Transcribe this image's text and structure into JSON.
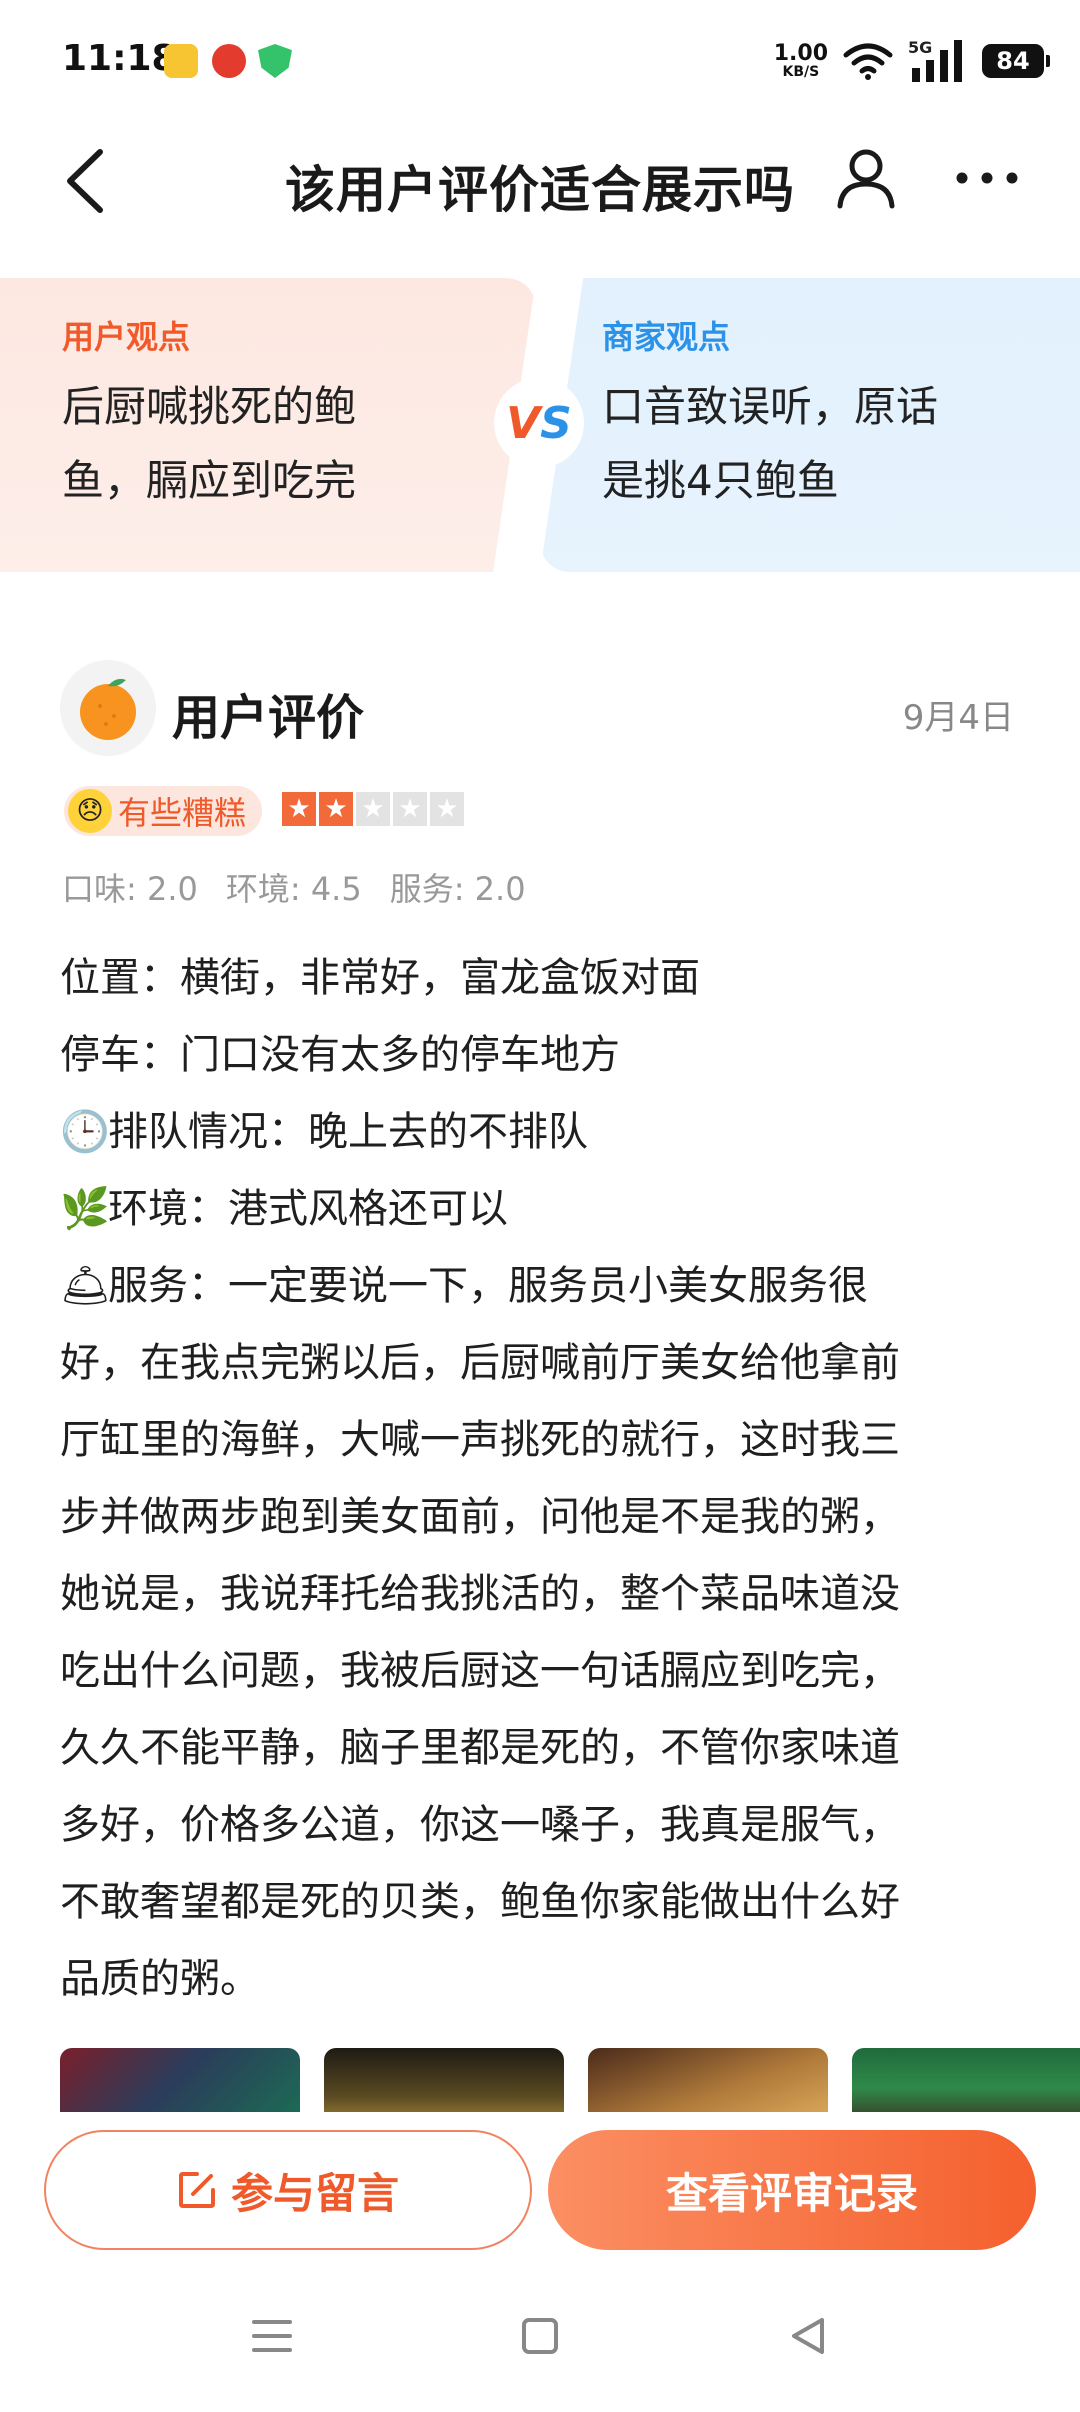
{
  "status_bar": {
    "time": "11:18",
    "net_speed_value": "1.00",
    "net_speed_unit": "KB/S",
    "network": "5G",
    "battery": "84"
  },
  "nav": {
    "title": "该用户评价适合展示吗",
    "icons": [
      "back-icon",
      "user-icon",
      "more-icon"
    ]
  },
  "vs": {
    "user_label": "用户观点",
    "user_lines": [
      "后厨喊挑死的鲍",
      "鱼，膈应到吃完"
    ],
    "badge_v": "V",
    "badge_s": "S",
    "biz_label": "商家观点",
    "biz_lines": [
      "口音致误听，原话",
      "是挑4只鲍鱼"
    ],
    "colors": {
      "user": "#f05a2b",
      "biz": "#2b92e8"
    }
  },
  "review": {
    "reviewer": "用户评价",
    "date": "9月4日",
    "mood": "有些糟糕",
    "rating": 2,
    "rating_max": 5,
    "scores": [
      "口味: 2.0",
      "环境: 4.5",
      "服务: 2.0"
    ],
    "lines": [
      "位置：横街，非常好，富龙盒饭对面",
      "停车：门口没有太多的停车地方",
      "排队情况：晚上去的不排队",
      "环境：港式风格还可以"
    ],
    "service_lines": [
      "服务：一定要说一下，服务员小美女服务很",
      "好，在我点完粥以后，后厨喊前厅美女给他拿前",
      "厅缸里的海鲜，大喊一声挑死的就行，这时我三",
      "步并做两步跑到美女面前，问他是不是我的粥，",
      "她说是，我说拜托给我挑活的，整个菜品味道没",
      "吃出什么问题，我被后厨这一句话膈应到吃完，",
      "久久不能平静，脑子里都是死的，不管你家味道",
      "多好，价格多公道，你这一嗓子，我真是服气，",
      "不敢奢望都是死的贝类，鲍鱼你家能做出什么好",
      "品质的粥。"
    ],
    "emoji": {
      "queue": "🕒",
      "env": "🌿",
      "service": "🛎"
    }
  },
  "actions": {
    "comment_label": "参与留言",
    "records_label": "查看评审记录"
  }
}
